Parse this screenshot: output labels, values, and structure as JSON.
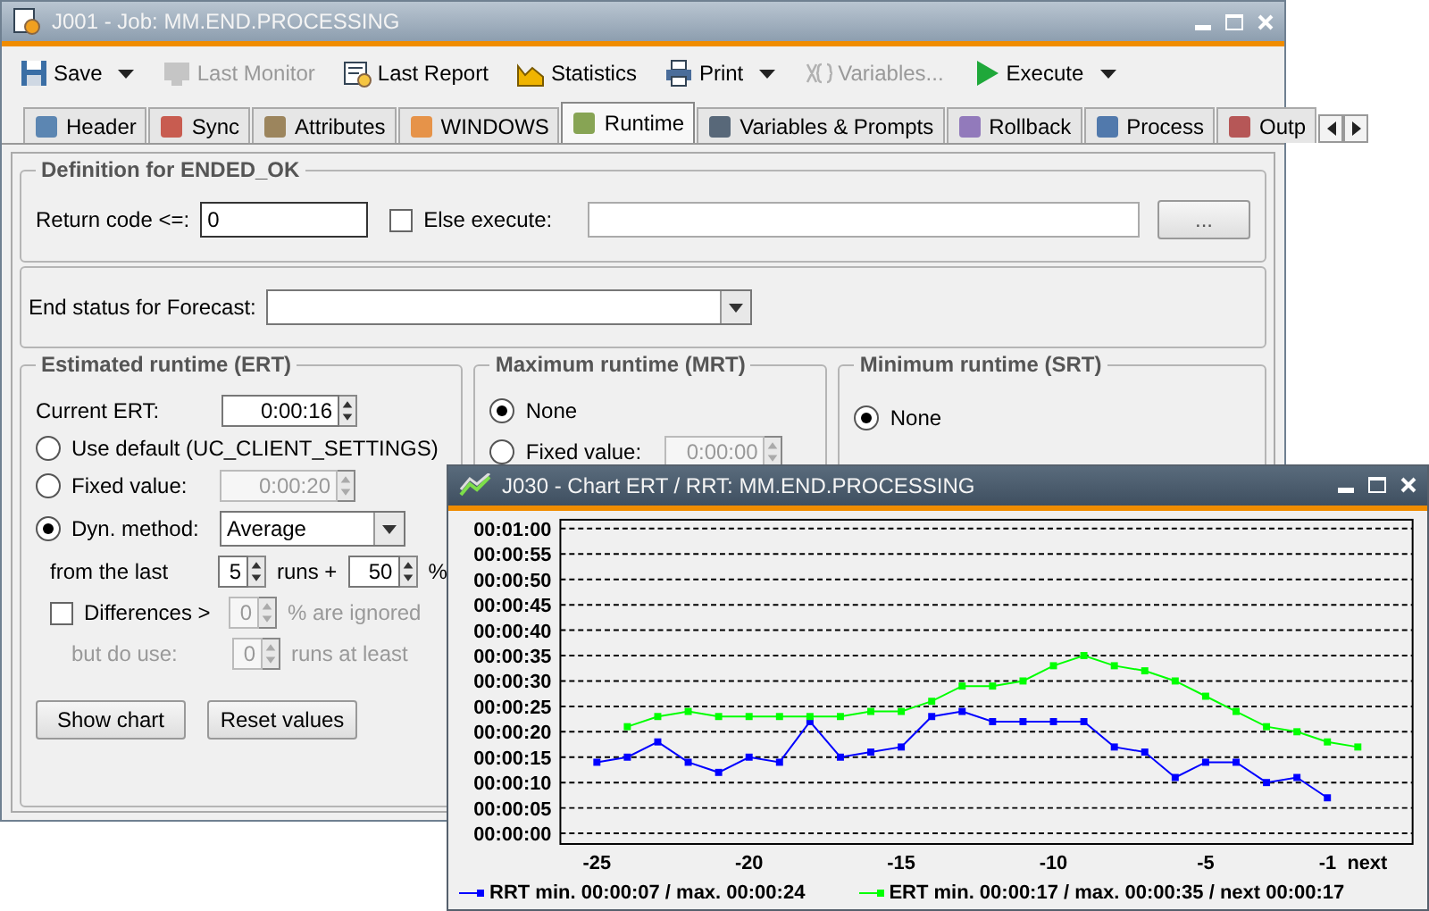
{
  "main_window": {
    "title": "J001 - Job: MM.END.PROCESSING"
  },
  "toolbar": [
    {
      "kind": "save",
      "label": "Save",
      "disabled": false,
      "dropdown": true
    },
    {
      "kind": "monitor",
      "label": "Last Monitor",
      "disabled": true,
      "dropdown": false
    },
    {
      "kind": "report",
      "label": "Last Report",
      "disabled": false,
      "dropdown": false
    },
    {
      "kind": "statistics",
      "label": "Statistics",
      "disabled": false,
      "dropdown": false
    },
    {
      "kind": "print",
      "label": "Print",
      "disabled": false,
      "dropdown": true
    },
    {
      "kind": "variables",
      "label": "Variables...",
      "disabled": true,
      "dropdown": false
    },
    {
      "kind": "execute",
      "label": "Execute",
      "disabled": false,
      "dropdown": true
    }
  ],
  "tabs": [
    {
      "label": "Header",
      "selected": false
    },
    {
      "label": "Sync",
      "selected": false
    },
    {
      "label": "Attributes",
      "selected": false
    },
    {
      "label": "WINDOWS",
      "selected": false
    },
    {
      "label": "Runtime",
      "selected": true
    },
    {
      "label": "Variables & Prompts",
      "selected": false
    },
    {
      "label": "Rollback",
      "selected": false
    },
    {
      "label": "Process",
      "selected": false
    },
    {
      "label": "Outp",
      "selected": false
    }
  ],
  "ended_ok": {
    "title": "Definition for ENDED_OK",
    "return_code_label": "Return code <=:",
    "return_code": "0",
    "else_execute": {
      "label": "Else execute:",
      "checked": false
    },
    "browse_button": "..."
  },
  "forecast": {
    "label": "End status for Forecast:"
  },
  "ert": {
    "title": "Estimated runtime (ERT)",
    "current_label": "Current ERT:",
    "current_value": "0:00:16",
    "options": [
      {
        "label": "Use default (UC_CLIENT_SETTINGS)",
        "selected": false
      },
      {
        "label": "Fixed value:",
        "selected": false,
        "value": "0:00:20"
      },
      {
        "label": "Dyn. method:",
        "selected": true,
        "value": "Average"
      }
    ],
    "from_label": "from the last",
    "runs": "5",
    "runs_label": "runs +",
    "percent": "50",
    "percent_label": "%",
    "differences": {
      "label": "Differences >",
      "checked": false,
      "value": "0",
      "suffix": "% are ignored"
    },
    "but_do_use": {
      "label": "but do use:",
      "value": "0",
      "suffix": "runs at least"
    },
    "buttons": [
      "Show chart",
      "Reset values"
    ]
  },
  "mrt": {
    "title": "Maximum runtime (MRT)",
    "options": [
      {
        "label": "None",
        "selected": true
      },
      {
        "label": "Fixed value:",
        "selected": false,
        "value": "0:00:00"
      }
    ]
  },
  "srt": {
    "title": "Minimum runtime (SRT)",
    "options": [
      {
        "label": "None",
        "selected": true
      }
    ]
  },
  "chart_window": {
    "title": "J030 - Chart ERT / RRT: MM.END.PROCESSING",
    "chart_data": {
      "type": "line",
      "x": [
        -25,
        -24,
        -23,
        -22,
        -21,
        -20,
        -19,
        -18,
        -17,
        -16,
        -15,
        -14,
        -13,
        -12,
        -11,
        -10,
        -9,
        -8,
        -7,
        -6,
        -5,
        -4,
        -3,
        -2,
        -1,
        0
      ],
      "series": [
        {
          "name": "RRT min. 00:00:07 / max. 00:00:24",
          "color": "#0000ff",
          "marker": "square",
          "values": [
            14,
            15,
            18,
            14,
            12,
            15,
            14,
            22,
            15,
            16,
            17,
            23,
            24,
            22,
            22,
            22,
            22,
            17,
            16,
            11,
            14,
            14,
            10,
            11,
            7,
            null
          ]
        },
        {
          "name": "ERT min. 00:00:17 / max. 00:00:35 / next 00:00:17",
          "color": "#00ff00",
          "marker": "square",
          "values": [
            null,
            21,
            23,
            24,
            23,
            23,
            23,
            23,
            23,
            24,
            24,
            26,
            29,
            29,
            30,
            33,
            35,
            33,
            32,
            30,
            27,
            24,
            21,
            20,
            18,
            17
          ]
        }
      ],
      "xlim": [
        -26.2,
        1.8
      ],
      "ylim": [
        0,
        60
      ],
      "grid": true,
      "xticks": [
        -25,
        -20,
        -15,
        -10,
        -5,
        {
          "value": -1,
          "label": "-1"
        },
        {
          "value": 0,
          "label": "next"
        }
      ],
      "yticks": [
        {
          "value": 0,
          "label": "00:00:00"
        },
        {
          "value": 5,
          "label": "00:00:05"
        },
        {
          "value": 10,
          "label": "00:00:10"
        },
        {
          "value": 15,
          "label": "00:00:15"
        },
        {
          "value": 20,
          "label": "00:00:20"
        },
        {
          "value": 25,
          "label": "00:00:25"
        },
        {
          "value": 30,
          "label": "00:00:30"
        },
        {
          "value": 35,
          "label": "00:00:35"
        },
        {
          "value": 40,
          "label": "00:00:40"
        },
        {
          "value": 45,
          "label": "00:00:45"
        },
        {
          "value": 50,
          "label": "00:00:50"
        },
        {
          "value": 55,
          "label": "00:00:55"
        },
        {
          "value": 60,
          "label": "00:01:00"
        }
      ]
    }
  }
}
